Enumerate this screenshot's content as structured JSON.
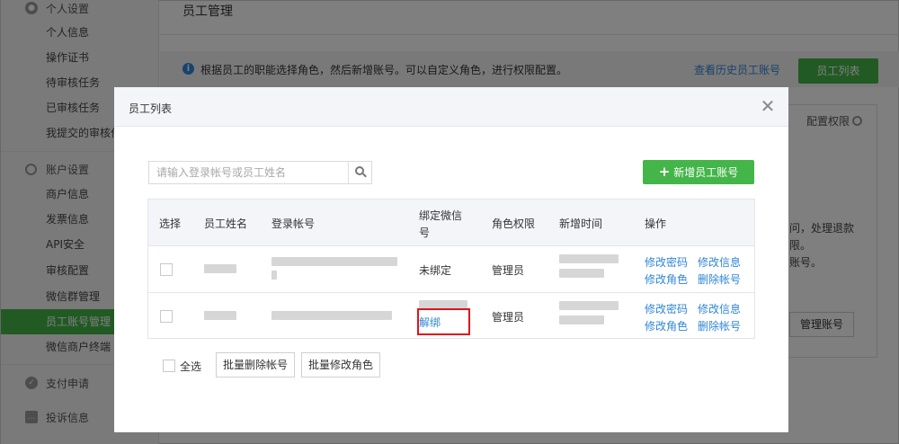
{
  "sidebar": {
    "group_personal": "个人设置",
    "personal_items": [
      "个人信息",
      "操作证书",
      "待审核任务",
      "已审核任务",
      "我提交的审核任务"
    ],
    "group_account": "账户设置",
    "account_items": [
      "商户信息",
      "发票信息",
      "API安全",
      "审核配置",
      "微信群管理",
      "员工账号管理",
      "微信商户终端"
    ],
    "active_item": "员工账号管理",
    "group_pay": "支付申请",
    "group_complaint": "投诉信息"
  },
  "main": {
    "title": "员工管理",
    "info_text": "根据员工的职能选择角色，然后新增账号。可以自定义角色，进行权限配置。",
    "history_link": "查看历史员工账号",
    "emp_list_button": "员工列表",
    "perm_config": "配置权限",
    "bg_text_1": "问，处理退款",
    "bg_text_2": "限。",
    "bg_text_3": "账号。",
    "manage_button": "管理账号"
  },
  "modal": {
    "title": "员工列表",
    "close_glyph": "✕",
    "search": {
      "placeholder": "请输入登录帐号或员工姓名",
      "value": ""
    },
    "add_button": "新增员工账号",
    "headers": [
      "选择",
      "员工姓名",
      "登录帐号",
      "绑定微信号",
      "角色权限",
      "新增时间",
      "操作"
    ],
    "rows": [
      {
        "wechat": "未绑定",
        "role": "管理员",
        "actions": [
          "修改密码",
          "修改信息",
          "修改角色",
          "删除帐号"
        ]
      },
      {
        "wechat": "解绑",
        "role": "管理员",
        "actions": [
          "修改密码",
          "修改信息",
          "修改角色",
          "删除帐号"
        ]
      }
    ],
    "select_all": "全选",
    "batch_delete": "批量删除帐号",
    "batch_role": "批量修改角色"
  },
  "colors": {
    "accent_green": "#44b549",
    "link_blue": "#2f86d8",
    "highlight_red": "#e2141b"
  }
}
